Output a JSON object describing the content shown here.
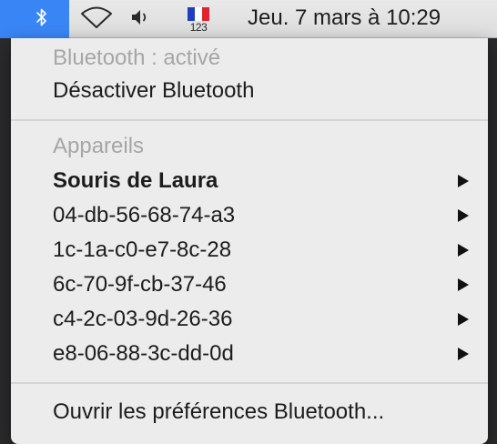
{
  "menubar": {
    "bluetooth_icon": "bluetooth-icon",
    "wifi_icon": "wifi-icon",
    "volume_icon": "volume-icon",
    "input_source": {
      "icon": "french-flag-icon",
      "label": "123"
    },
    "clock": "Jeu. 7 mars à 10:29",
    "accent_color": "#3a85f6"
  },
  "menu": {
    "status": "Bluetooth : activé",
    "toggle_label": "Désactiver Bluetooth",
    "devices_header": "Appareils",
    "devices": [
      {
        "name": "Souris de Laura",
        "connected": true
      },
      {
        "name": "04-db-56-68-74-a3",
        "connected": false
      },
      {
        "name": "1c-1a-c0-e7-8c-28",
        "connected": false
      },
      {
        "name": "6c-70-9f-cb-37-46",
        "connected": false
      },
      {
        "name": "c4-2c-03-9d-26-36",
        "connected": false
      },
      {
        "name": "e8-06-88-3c-dd-0d",
        "connected": false
      }
    ],
    "submenu_icon": "submenu-arrow-icon",
    "preferences_label": "Ouvrir les préférences Bluetooth..."
  }
}
